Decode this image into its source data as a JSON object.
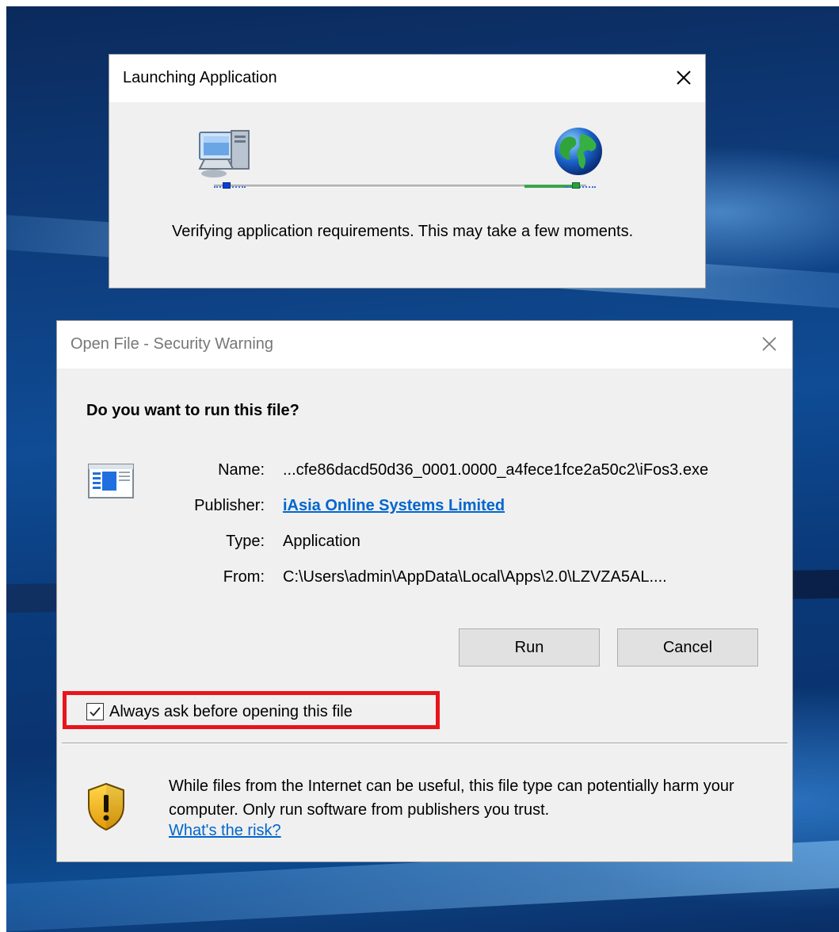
{
  "launch_window": {
    "title": "Launching Application",
    "message": "Verifying application requirements. This may take a few moments."
  },
  "security_dialog": {
    "title": "Open File - Security Warning",
    "question": "Do you want to run this file?",
    "fields": [
      {
        "label": "Name:",
        "value": "...cfe86dacd50d36_0001.0000_a4fece1fce2a50c2\\iFos3.exe"
      },
      {
        "label": "Publisher:",
        "value": "iAsia Online Systems Limited"
      },
      {
        "label": "Type:",
        "value": "Application"
      },
      {
        "label": "From:",
        "value": "C:\\Users\\admin\\AppData\\Local\\Apps\\2.0\\LZVZA5AL...."
      }
    ],
    "run_label": "Run",
    "cancel_label": "Cancel",
    "checkbox_label": "Always ask before opening this file",
    "checkbox_checked": true,
    "warning_text": "While files from the Internet can be useful, this file type can potentially harm your computer. Only run software from publishers you trust.",
    "risk_link": "What's the risk?"
  },
  "colors": {
    "link": "#0066cc",
    "highlight_border": "#e8141c",
    "dialog_bg": "#f0f0f0"
  },
  "icons": [
    "close-icon",
    "computer-icon",
    "globe-icon",
    "application-file-icon",
    "shield-warning-icon",
    "checkmark-icon"
  ]
}
